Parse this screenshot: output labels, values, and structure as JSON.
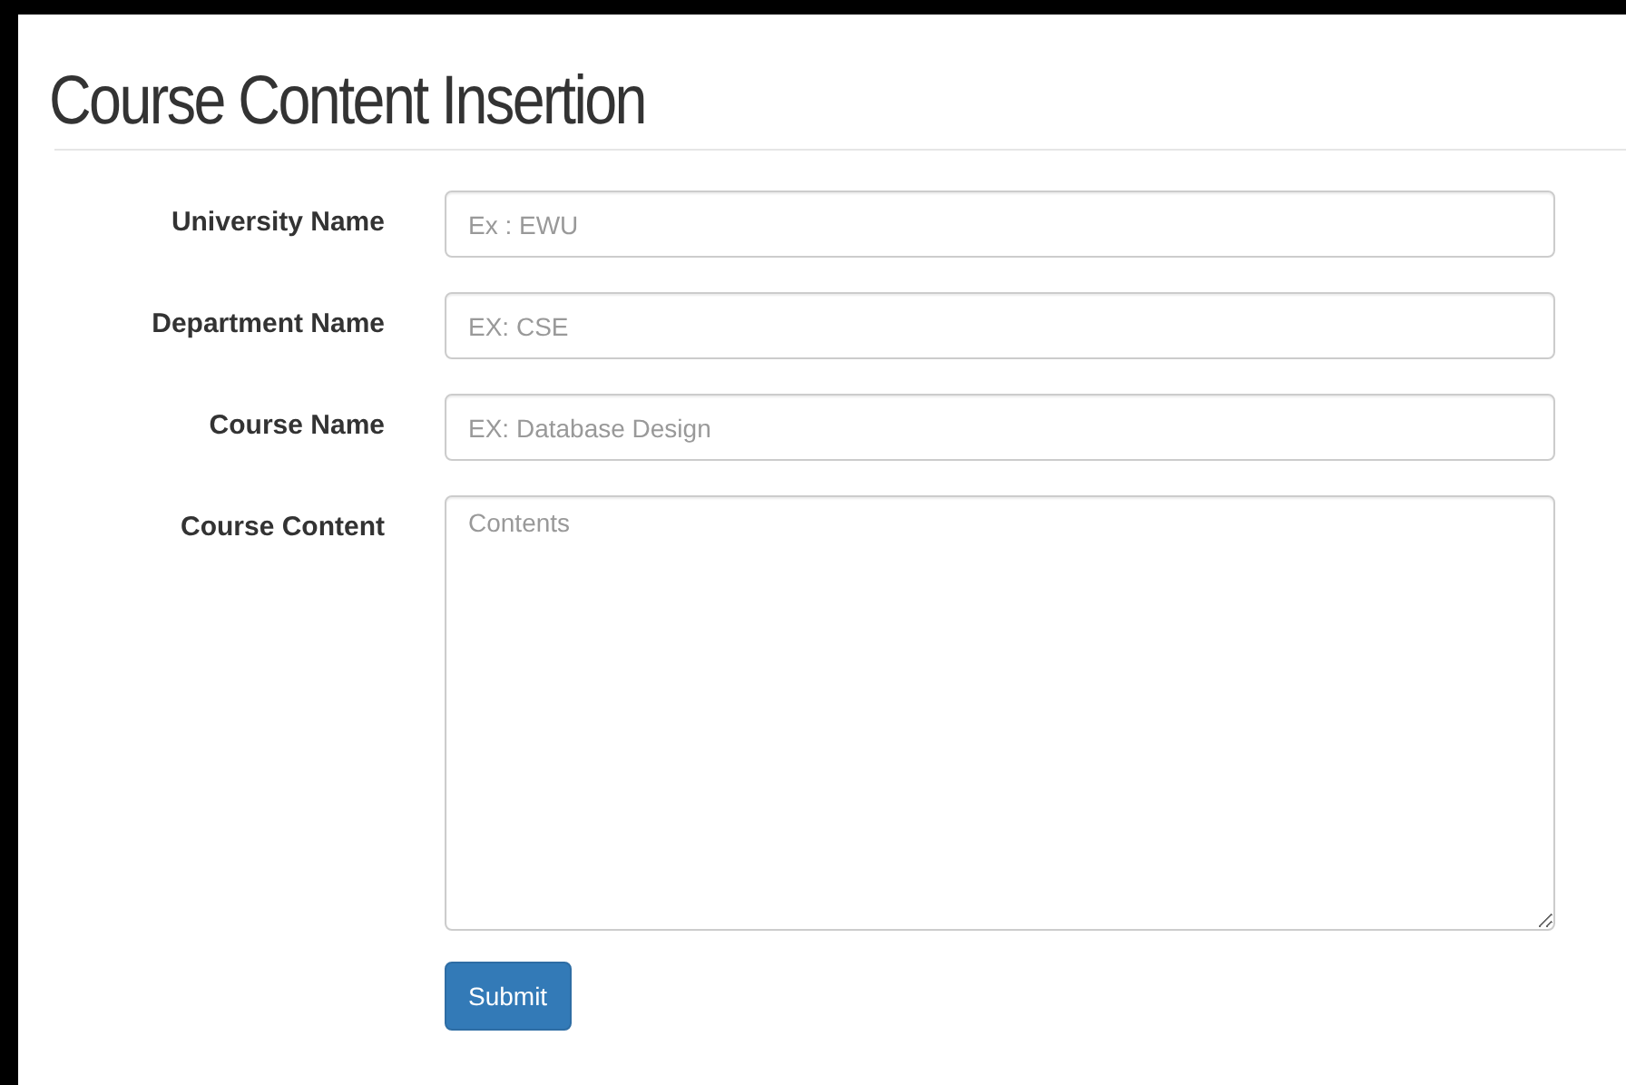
{
  "title": "Course Content Insertion",
  "fields": [
    {
      "kind": "input",
      "label": "University Name",
      "placeholder": "Ex : EWU"
    },
    {
      "kind": "input",
      "label": "Department Name",
      "placeholder": "EX: CSE"
    },
    {
      "kind": "input",
      "label": "Course Name",
      "placeholder": "EX: Database Design"
    },
    {
      "kind": "textarea",
      "label": "Course Content",
      "placeholder": "Contents"
    }
  ],
  "submit": "Submit"
}
